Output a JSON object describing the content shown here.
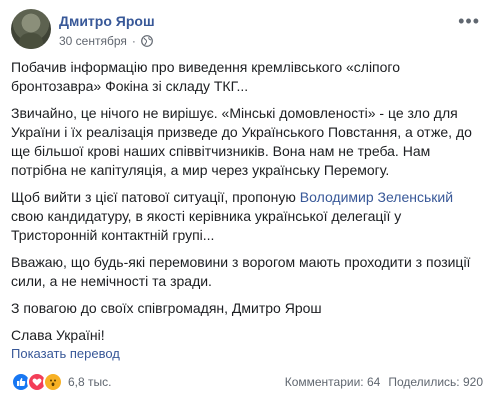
{
  "post": {
    "author": "Дмитро Ярош",
    "date": "30 сентября",
    "separator": "·",
    "paragraphs": {
      "p1": "Побачив інформацію про виведення кремлівського «сліпого\nбронтозавра» Фокіна зі складу ТКГ...",
      "p2": "Звичайно, це нічого не вирішує. «Мінські домовленості» - це зло для\nУкраїни і їх реалізація призведе до Українського Повстання, а отже, до\nще більшої крові наших співвітчизників. Вона нам не треба. Нам\nпотрібна не капітуляція, а мир через українську Перемогу.",
      "p3_before": "Щоб вийти з цієї патової ситуації, пропоную ",
      "p3_link": "Володимир Зеленський",
      "p3_after": "\nсвою кандидатуру, в якості керівника української делегації у\nТристоронній контактній групі...",
      "p4": "Вважаю, що будь-які перемовини з ворогом мають проходити з позиції\nсили, а не немічності та зради.",
      "p5": "З повагою до своїх співгромадян, Дмитро Ярош",
      "p6": "Слава Україні!"
    },
    "translate_link": "Показать перевод"
  },
  "footer": {
    "reaction_icons": [
      "like-icon",
      "love-icon",
      "wow-icon"
    ],
    "reaction_count": "6,8 тыс.",
    "comments": "Комментарии: 64",
    "shares": "Поделились: 920"
  },
  "colors": {
    "link": "#385898",
    "text": "#1c1e21",
    "meta": "#616770",
    "like": "#1877f2",
    "love": "#f33e58",
    "wow": "#f7b125"
  }
}
